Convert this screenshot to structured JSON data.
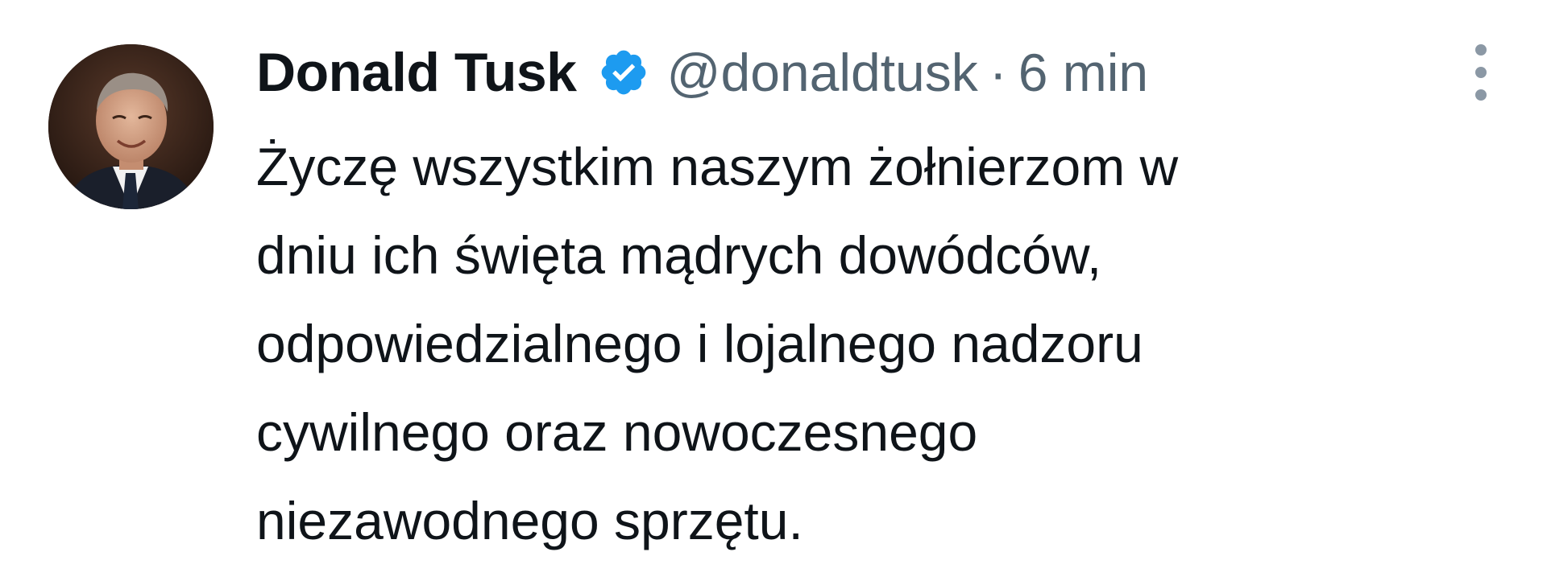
{
  "tweet": {
    "author": {
      "name": "Donald Tusk",
      "handle": "@donaldtusk",
      "verified": true
    },
    "separator": "·",
    "timestamp": "6 min",
    "lines": [
      "Życzę wszystkim naszym żołnierzom w",
      "dniu ich święta mądrych dowódców,",
      "odpowiedzialnego i lojalnego nadzoru",
      "cywilnego oraz nowoczesnego",
      "niezawodnego sprzętu."
    ]
  },
  "icons": {
    "verified": "verified-badge-icon",
    "more": "more-options-icon"
  },
  "colors": {
    "text": "#0f1419",
    "secondary": "#536471",
    "verified": "#1d9bf0",
    "background": "#ffffff"
  }
}
